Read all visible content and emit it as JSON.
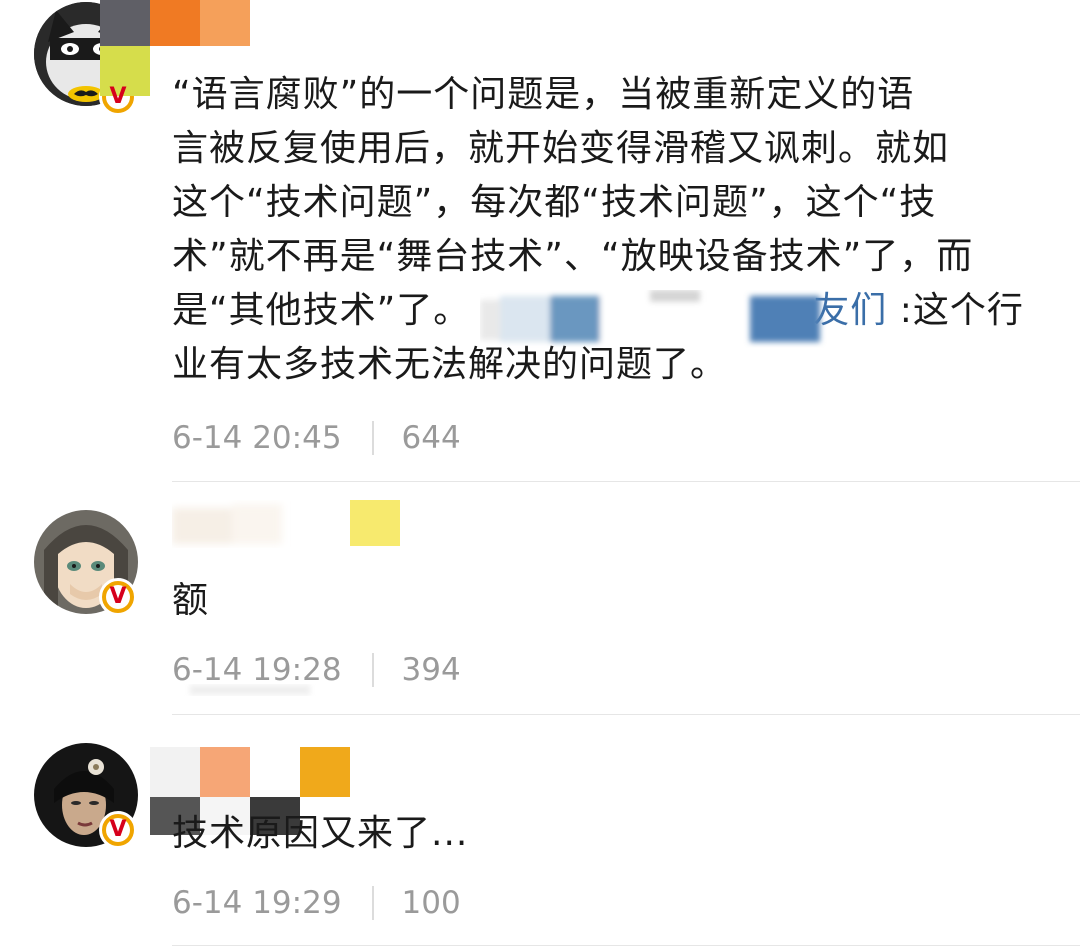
{
  "comments": [
    {
      "text_line1": "“语言腐败”的一个问题是，当被重新定义的语",
      "text_line2": "言被反复使用后，就开始变得滑稽又讽刺。就如",
      "text_line3": "这个“技术问题”，每次都“技术问题”，这个“技",
      "text_line4": "术”就不再是“舞台技术”、“放映设备技术”了，而",
      "text_line5_a": "是“其他技术”了。",
      "text_line5_mention": "友们",
      "text_line5_b": ":这个行",
      "text_line6": "业有太多技术无法解决的问题了。",
      "time": "6-14 20:45",
      "likes": "644"
    },
    {
      "text": "额",
      "time": "6-14 19:28",
      "likes": "394",
      "badge": "V"
    },
    {
      "text": "技术原因又来了...",
      "time": "6-14 19:29",
      "likes": "100",
      "badge": "V"
    }
  ],
  "colors": {
    "text": "#1a1a1a",
    "meta": "#9a9a9a",
    "mention": "#3a6ea8",
    "badge_fill": "#f0a500",
    "badge_letter": "#d6001c"
  },
  "icons": {
    "avatar1": "batman-avatar-icon",
    "avatar2": "anime-girl-avatar-icon",
    "avatar3": "woman-portrait-avatar-icon",
    "badge": "verified-v-badge-icon"
  }
}
